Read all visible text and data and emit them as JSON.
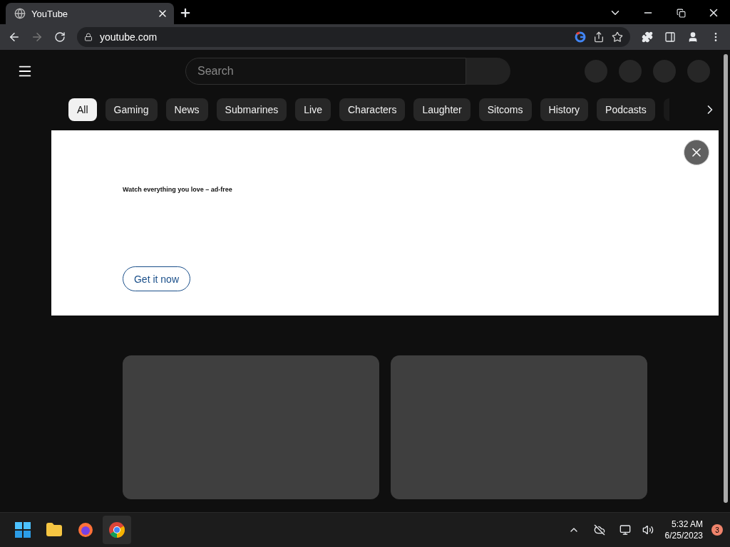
{
  "browser": {
    "tab": {
      "title": "YouTube"
    },
    "address": "youtube.com"
  },
  "masthead": {
    "search": {
      "placeholder": "Search"
    }
  },
  "chips": [
    {
      "label": "All",
      "selected": true
    },
    {
      "label": "Gaming",
      "selected": false
    },
    {
      "label": "News",
      "selected": false
    },
    {
      "label": "Submarines",
      "selected": false
    },
    {
      "label": "Live",
      "selected": false
    },
    {
      "label": "Characters",
      "selected": false
    },
    {
      "label": "Laughter",
      "selected": false
    },
    {
      "label": "Sitcoms",
      "selected": false
    },
    {
      "label": "History",
      "selected": false
    },
    {
      "label": "Podcasts",
      "selected": false
    }
  ],
  "ad": {
    "headline": "Watch everything you love – ad-free",
    "button": "Get it now"
  },
  "taskbar": {
    "time": "5:32 AM",
    "date": "6/25/2023",
    "notifications": "3"
  }
}
